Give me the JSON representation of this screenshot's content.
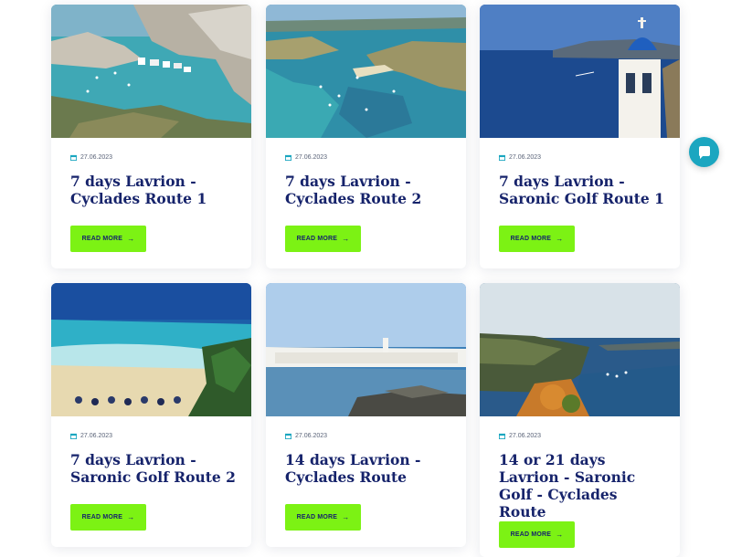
{
  "cards": [
    {
      "date": "27.06.2023",
      "title": "7 days Lavrion - Cyclades Route 1",
      "button": "READ MORE"
    },
    {
      "date": "27.06.2023",
      "title": "7 days Lavrion - Cyclades Route 2",
      "button": "READ MORE"
    },
    {
      "date": "27.06.2023",
      "title": "7 days Lavrion - Saronic Golf Route 1",
      "button": "READ MORE"
    },
    {
      "date": "27.06.2023",
      "title": "7 days Lavrion - Saronic Golf Route 2",
      "button": "READ MORE"
    },
    {
      "date": "27.06.2023",
      "title": "14 days Lavrion - Cyclades Route",
      "button": "READ MORE"
    },
    {
      "date": "27.06.2023",
      "title": "14 or 21 days Lavrion - Saronic Golf - Cyclades Route",
      "button": "READ MORE"
    }
  ],
  "chat": {
    "icon": "chat-bubble-icon"
  },
  "colors": {
    "accent": "#7cf214",
    "title": "#16236b",
    "chat": "#1ba6c0"
  }
}
